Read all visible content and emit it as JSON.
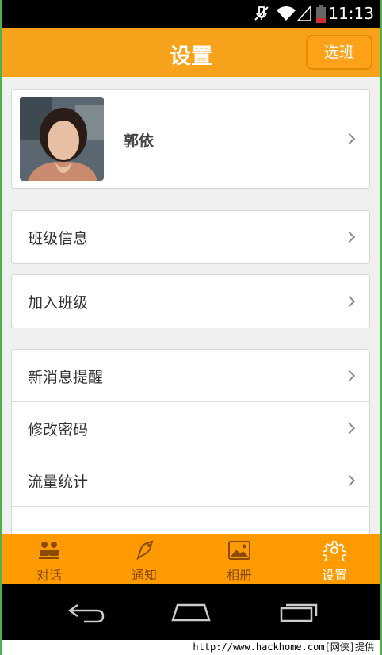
{
  "status_bar": {
    "time": "11:13"
  },
  "header": {
    "title": "设置",
    "pick_class_label": "选班"
  },
  "profile": {
    "name": "郭依"
  },
  "class_rows": [
    {
      "label": "班级信息"
    },
    {
      "label": "加入班级"
    }
  ],
  "settings_rows": [
    {
      "label": "新消息提醒"
    },
    {
      "label": "修改密码"
    },
    {
      "label": "流量统计"
    }
  ],
  "tabs": [
    {
      "label": "对话",
      "icon": "chat-icon"
    },
    {
      "label": "通知",
      "icon": "bell-icon"
    },
    {
      "label": "相册",
      "icon": "image-icon"
    },
    {
      "label": "设置",
      "icon": "gear-icon",
      "active": true
    }
  ],
  "watermark": "http://www.hackhome.com[网侠]提供",
  "colors": {
    "accent": "#f7a21b",
    "tabbar": "#ff9b00",
    "active_tab": "#ffffff",
    "inactive_tab": "#8a4a00"
  }
}
